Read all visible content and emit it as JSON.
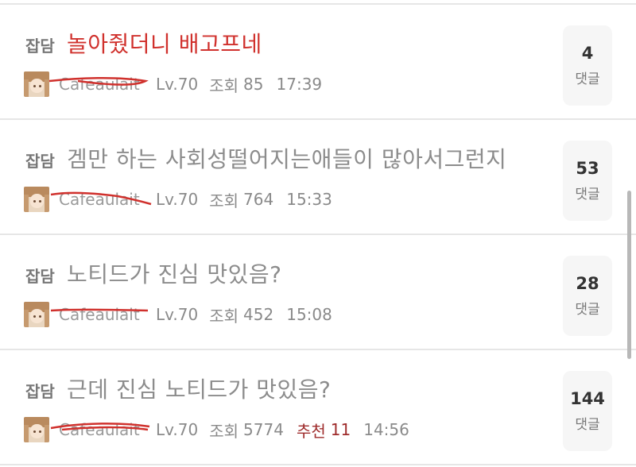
{
  "posts": [
    {
      "category": "잡담",
      "title": "놀아줬더니 배고프네",
      "title_color": "#d0312d",
      "author": "Cafeaulait",
      "level": "Lv.70",
      "views_label": "조회",
      "views": "85",
      "time": "17:39",
      "comments": "4",
      "comments_label": "댓글"
    },
    {
      "category": "잡담",
      "title": "겜만 하는 사회성떨어지는애들이 많아서그런지",
      "author": "Cafeaulait",
      "level": "Lv.70",
      "views_label": "조회",
      "views": "764",
      "time": "15:33",
      "comments": "53",
      "comments_label": "댓글"
    },
    {
      "category": "잡담",
      "title": "노티드가 진심 맛있음?",
      "author": "Cafeaulait",
      "level": "Lv.70",
      "views_label": "조회",
      "views": "452",
      "time": "15:08",
      "comments": "28",
      "comments_label": "댓글"
    },
    {
      "category": "잡담",
      "title": "근데 진심 노티드가 맛있음?",
      "author": "Cafeaulait",
      "level": "Lv.70",
      "views_label": "조회",
      "views": "5774",
      "recommend_label": "추천",
      "recommend": "11",
      "time": "14:56",
      "comments": "144",
      "comments_label": "댓글"
    }
  ],
  "colors": {
    "strike": "#d0312d",
    "recommend": "#9e2b2b"
  }
}
